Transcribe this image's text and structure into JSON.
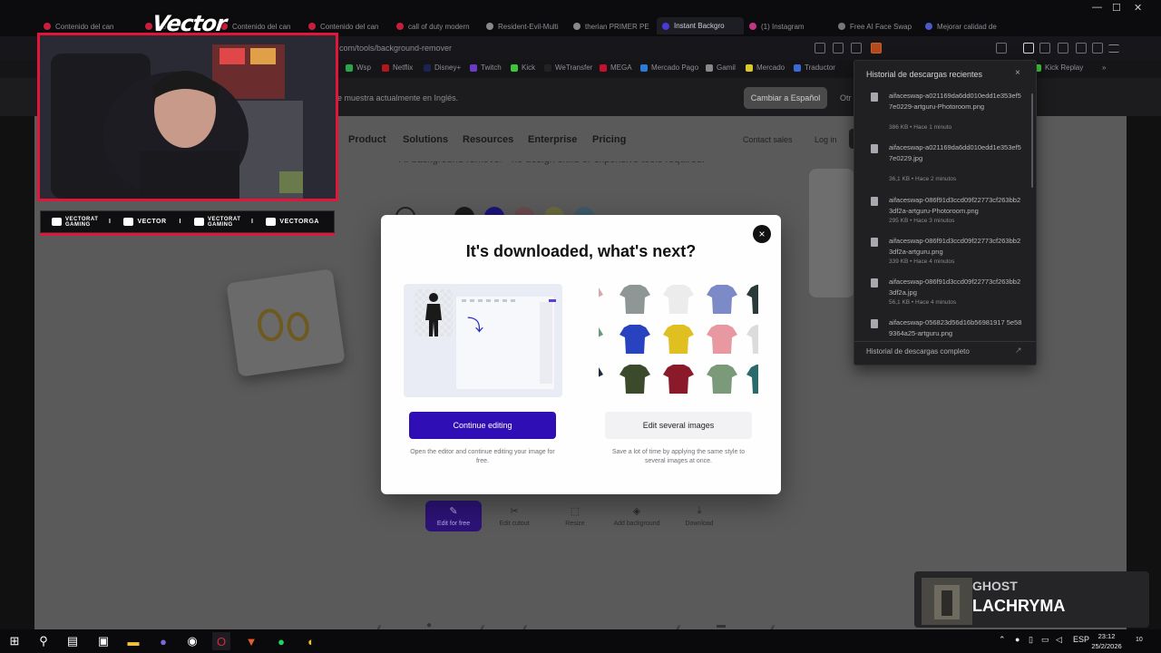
{
  "tabs": [
    "Contenido del can",
    "Co",
    "Contenido del can",
    "Contenido del can",
    "call of duty modern",
    "Resident-Evil-Multi",
    "therian PRIMER PE",
    "Instant Backgro",
    "(1) Instagram",
    "Free AI Face Swap",
    "Mejorar calidad de"
  ],
  "window_controls": [
    "—",
    "☐",
    "✕"
  ],
  "address": {
    "url": "com/tools/background-remover"
  },
  "bookmarks": [
    "Wsp",
    "Netflix",
    "Disney+",
    "Twitch",
    "Kick",
    "WeTransfer",
    "MEGA",
    "Mercado Pago",
    "Gamil",
    "Mercado",
    "Traductor",
    "Kick Replay"
  ],
  "bookmarks_more": "»",
  "lang_bar": {
    "text": "e muestra actualmente en Inglés.",
    "button": "Cambiar a Español",
    "other": "Otr"
  },
  "site": {
    "nav": [
      "Product",
      "Solutions",
      "Resources",
      "Enterprise",
      "Pricing"
    ],
    "contact": "Contact sales",
    "login": "Log in",
    "partial_text": "AI background remover - no design skills or expensive tools required.",
    "tools": [
      "Edit for free",
      "Edit cutout",
      "Resize",
      "Add background",
      "Download"
    ]
  },
  "modal": {
    "title": "It's downloaded, what's next?",
    "close": "×",
    "continue_label": "Continue editing",
    "continue_desc": "Open the editor and continue editing your image for free.",
    "several_label": "Edit several images",
    "several_desc": "Save a lot of time by applying the same style to several images at once."
  },
  "downloads": {
    "title": "Historial de descargas recientes",
    "close": "×",
    "items": [
      {
        "name": "aifaceswap-a021169da6dd010edd1e353ef57e0229-artguru-Photoroom.png",
        "meta": "386 KB • Hace 1 minuto"
      },
      {
        "name": "aifaceswap-a021169da6dd010edd1e353ef57e0229.jpg",
        "meta": "36,1 KB • Hace 2 minutos"
      },
      {
        "name": "aifaceswap-086f91d3ccd09f22773cf263bb23df2a-artguru-Photoroom.png",
        "meta": "295 KB • Hace 3 minutos"
      },
      {
        "name": "aifaceswap-086f91d3ccd09f22773cf263bb23df2a-artguru.png",
        "meta": "339 KB • Hace 4 minutos"
      },
      {
        "name": "aifaceswap-086f91d3ccd09f22773cf263bb23df2a.jpg",
        "meta": "56,1 KB • Hace 4 minutos"
      },
      {
        "name": "aifaceswap-056823d56d16b56981917 5e589364a25-artguru.png",
        "meta": ""
      }
    ],
    "full_history": "Historial de descargas completo"
  },
  "stream": {
    "logo": "Vector",
    "socials": [
      {
        "label": "VECTORAT GAMING"
      },
      {
        "label": "VECTOR"
      },
      {
        "label": "VECTORAT GAMING"
      },
      {
        "label": "VECTORGA"
      }
    ],
    "separator": "I"
  },
  "music": {
    "title": "GHOST",
    "artist": "LACHRYMA"
  },
  "taskbar": {
    "language": "ESP",
    "time": "23:12",
    "date": "25/2/2026",
    "notifications": "10"
  },
  "colors": {
    "accent": "#2f0fb5",
    "stream_red": "#e2153b",
    "panel_bg": "#202023"
  }
}
